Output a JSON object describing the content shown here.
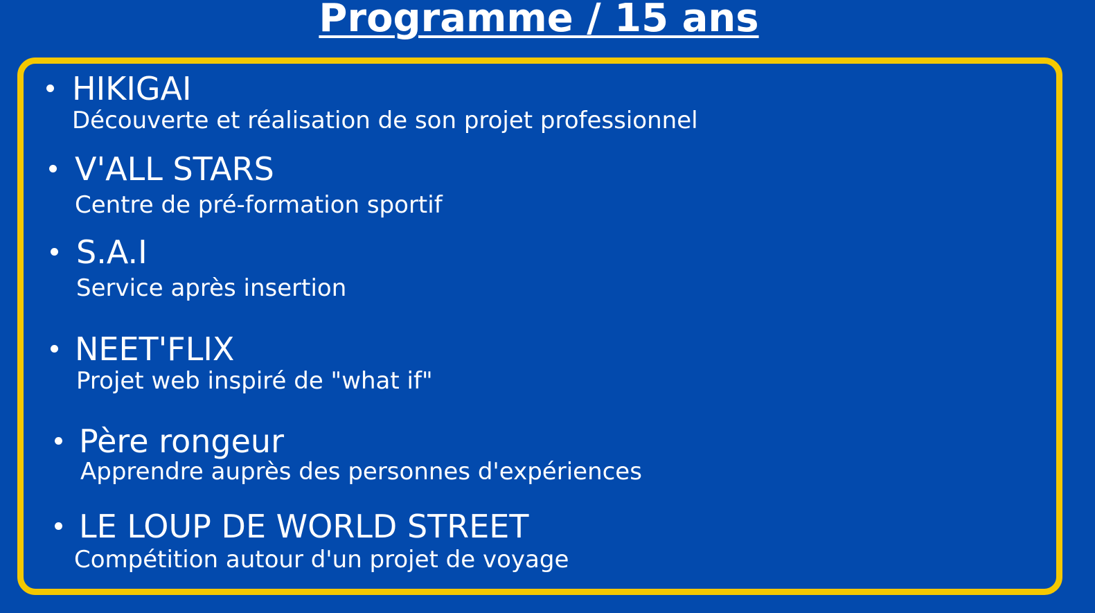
{
  "title": "Programme / 15 ans",
  "colors": {
    "background": "#034aad",
    "border": "#f5c800",
    "text": "#ffffff"
  },
  "items": [
    {
      "title": "HIKIGAI",
      "description": "Découverte et réalisation de son projet professionnel"
    },
    {
      "title": "V'ALL STARS",
      "description": "Centre de pré-formation sportif"
    },
    {
      "title": "S.A.I",
      "description": "Service après insertion"
    },
    {
      "title": "NEET'FLIX",
      "description": "Projet web inspiré de \"what if\""
    },
    {
      "title": "Père rongeur",
      "description": "Apprendre auprès des personnes d'expériences"
    },
    {
      "title": "LE LOUP DE WORLD STREET",
      "description": "Compétition autour d'un projet de voyage"
    }
  ]
}
